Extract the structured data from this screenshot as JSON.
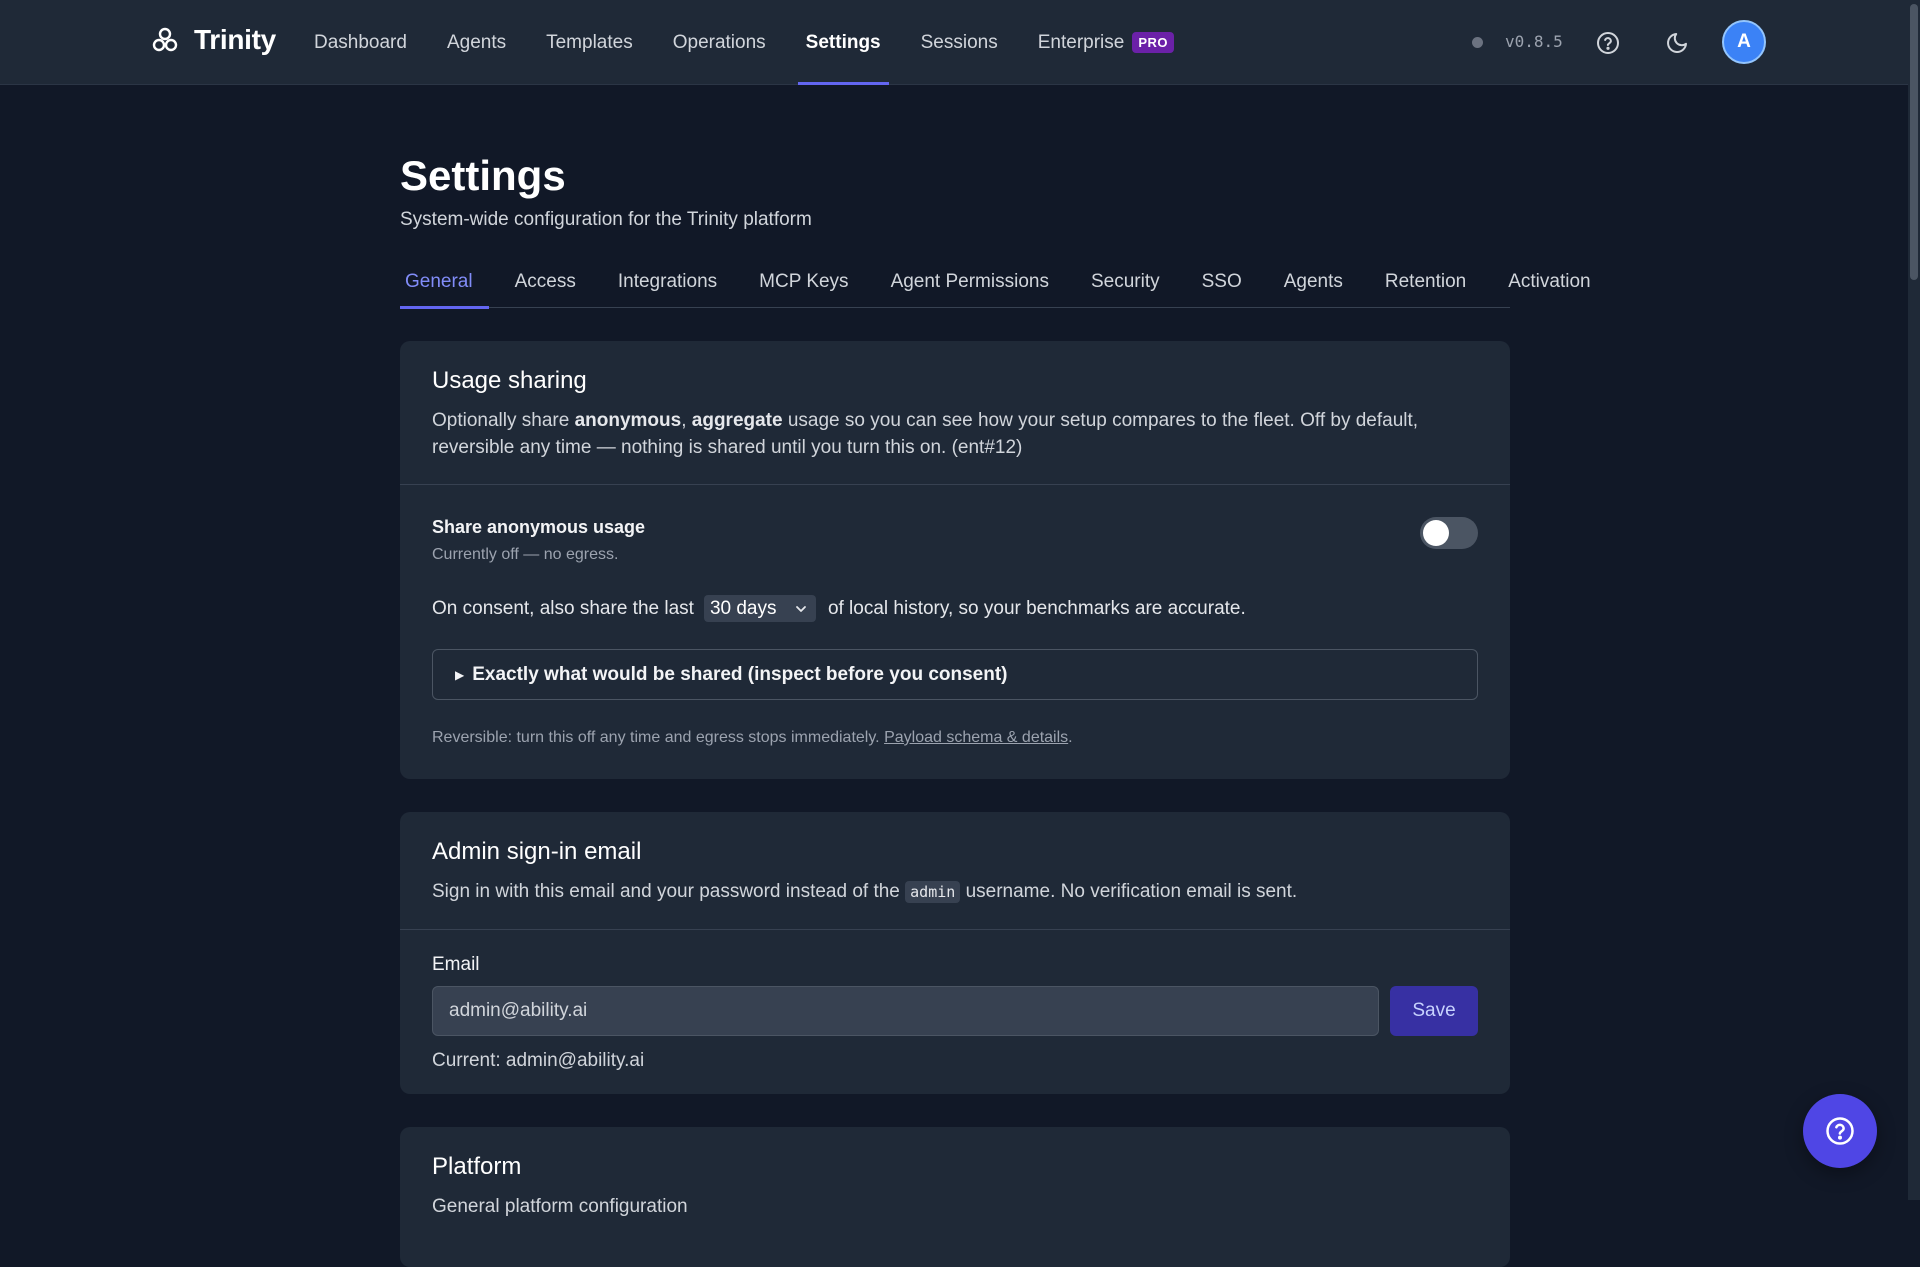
{
  "brand": {
    "name": "Trinity",
    "icon": "trinity-logo-icon"
  },
  "nav": {
    "items": [
      {
        "label": "Dashboard"
      },
      {
        "label": "Agents"
      },
      {
        "label": "Templates"
      },
      {
        "label": "Operations"
      },
      {
        "label": "Settings",
        "active": true
      },
      {
        "label": "Sessions"
      },
      {
        "label": "Enterprise",
        "badge": "PRO"
      }
    ]
  },
  "header": {
    "version": "v0.8.5",
    "avatar_initial": "A",
    "help_icon": "help-circle-icon",
    "theme_icon": "moon-icon"
  },
  "page": {
    "title": "Settings",
    "subtitle": "System-wide configuration for the Trinity platform"
  },
  "tabs": [
    {
      "label": "General",
      "active": true
    },
    {
      "label": "Access"
    },
    {
      "label": "Integrations"
    },
    {
      "label": "MCP Keys"
    },
    {
      "label": "Agent Permissions"
    },
    {
      "label": "Security"
    },
    {
      "label": "SSO"
    },
    {
      "label": "Agents"
    },
    {
      "label": "Retention"
    },
    {
      "label": "Activation"
    }
  ],
  "usage_card": {
    "title": "Usage sharing",
    "desc_part1": "Optionally share ",
    "desc_bold1": "anonymous",
    "desc_sep": ", ",
    "desc_bold2": "aggregate",
    "desc_part2": " usage so you can see how your setup compares to the fleet. Off by default, reversible any time — nothing is shared until you turn this on. (ent#12)",
    "toggle_label": "Share anonymous usage",
    "toggle_sub": "Currently off — no egress.",
    "toggle_on": false,
    "consent_before": "On consent, also share the last",
    "consent_select": "30 days",
    "consent_after": "of local history, so your benchmarks are accurate.",
    "details_label": "Exactly what would be shared (inspect before you consent)",
    "note_text": "Reversible: turn this off any time and egress stops immediately. ",
    "note_link": "Payload schema & details",
    "note_end": "."
  },
  "email_card": {
    "title": "Admin sign-in email",
    "desc_part1": "Sign in with this email and your password instead of the ",
    "desc_code": "admin",
    "desc_part2": " username. No verification email is sent.",
    "field_label": "Email",
    "input_value": "admin@ability.ai",
    "save_label": "Save",
    "current_text": "Current: admin@ability.ai"
  },
  "platform_card": {
    "title": "Platform",
    "desc": "General platform configuration"
  },
  "colors": {
    "accent": "#6366f1",
    "background": "#111827",
    "card": "#1f2937",
    "pro_badge": "#6b21a8"
  }
}
